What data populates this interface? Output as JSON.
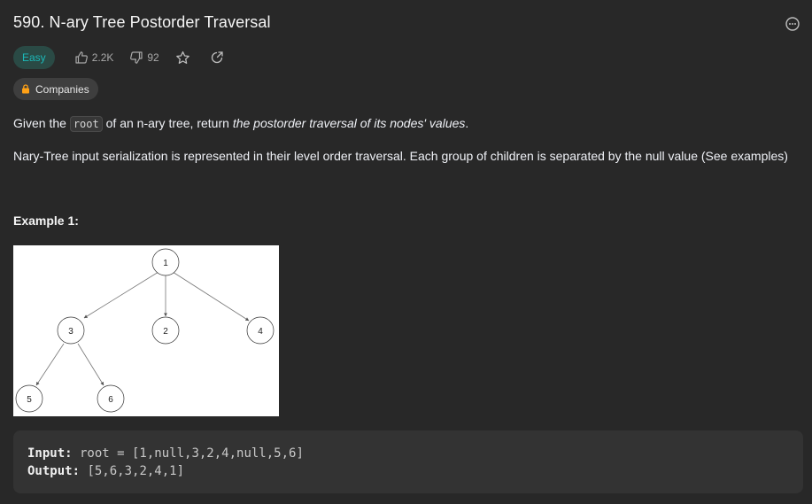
{
  "problem": {
    "title": "590. N-ary Tree Postorder Traversal",
    "difficulty": "Easy",
    "likes": "2.2K",
    "dislikes": "92",
    "companies_label": "Companies"
  },
  "description": {
    "p1_before": "Given the ",
    "p1_code": "root",
    "p1_middle": " of an n-ary tree, return ",
    "p1_em": "the postorder traversal of its nodes' values",
    "p1_after": ".",
    "p2": "Nary-Tree input serialization is represented in their level order traversal. Each group of children is separated by the null value (See examples)"
  },
  "example1": {
    "heading": "Example 1:",
    "tree_nodes": [
      "1",
      "3",
      "2",
      "4",
      "5",
      "6"
    ],
    "input_label": "Input:",
    "input_value": " root = [1,null,3,2,4,null,5,6]",
    "output_label": "Output:",
    "output_value": " [5,6,3,2,4,1]"
  },
  "colors": {
    "background": "#282828",
    "easy_text": "#1cb8b8",
    "easy_bg": "#2a4a45",
    "lock_icon": "#ffa116"
  },
  "icons": [
    "more-icon",
    "thumbs-up-icon",
    "thumbs-down-icon",
    "star-icon",
    "share-icon",
    "lock-icon"
  ]
}
